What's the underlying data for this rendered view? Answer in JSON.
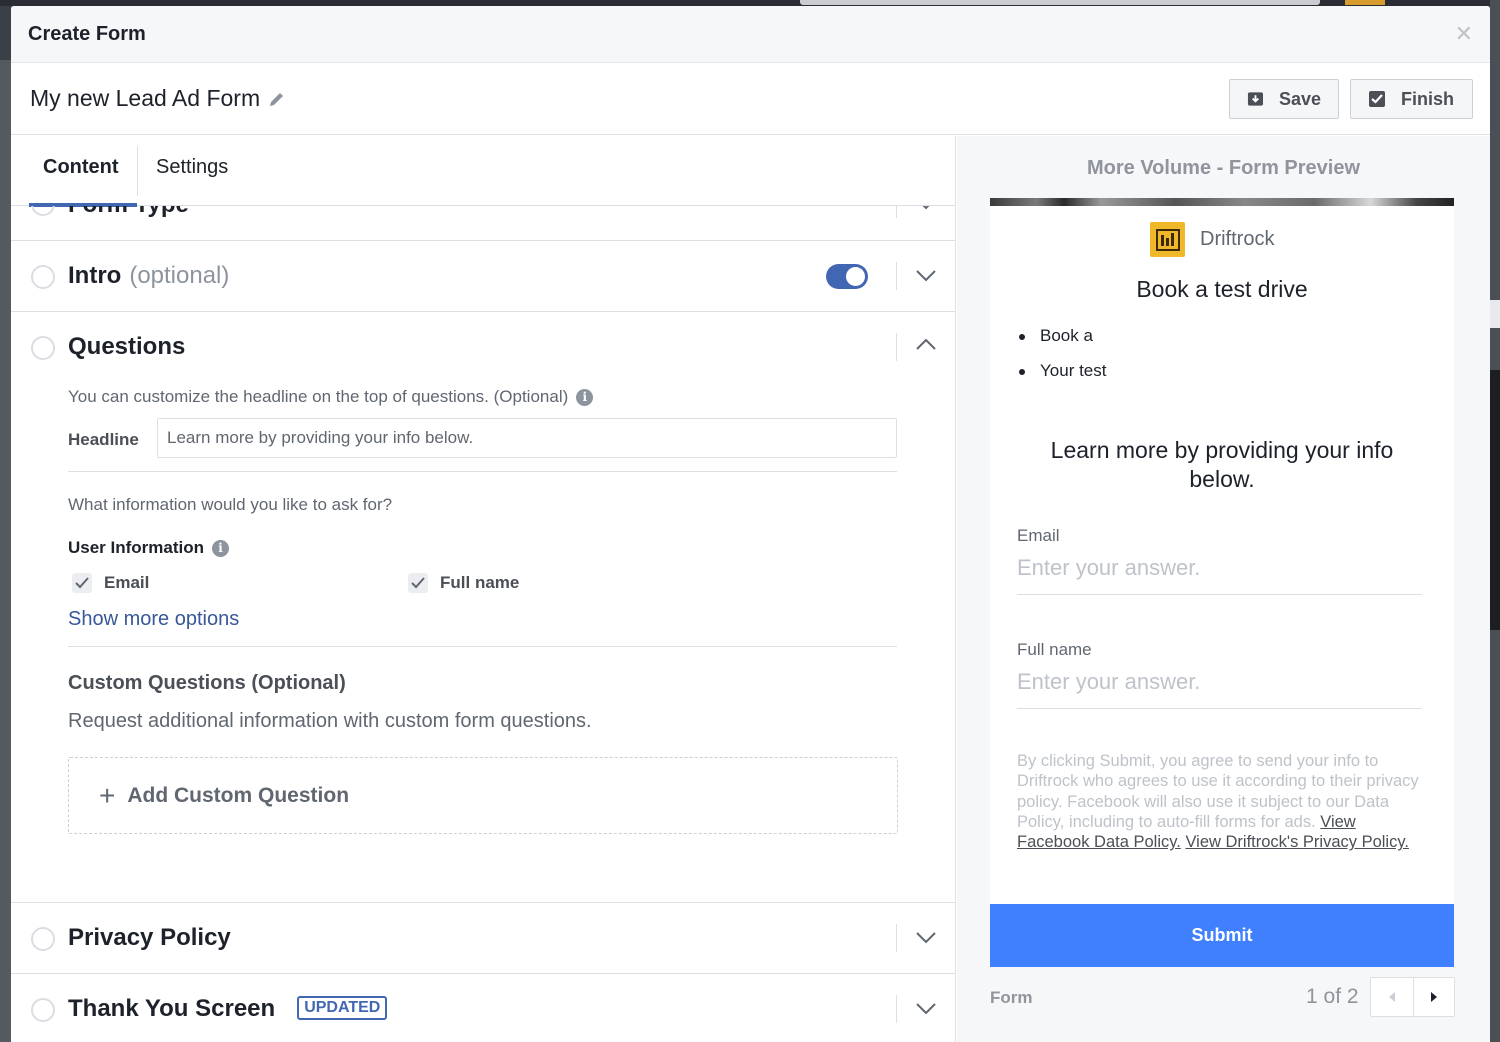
{
  "modal": {
    "title": "Create Form",
    "close_icon": "close-icon"
  },
  "form": {
    "name": "My new Lead Ad Form",
    "save_label": "Save",
    "finish_label": "Finish"
  },
  "tabs": [
    {
      "label": "Content",
      "active": true
    },
    {
      "label": "Settings",
      "active": false
    }
  ],
  "sections": {
    "form_type": {
      "title": "Form Type"
    },
    "intro": {
      "title": "Intro",
      "optional": "(optional)",
      "enabled": true
    },
    "questions": {
      "title": "Questions",
      "hint": "You can customize the headline on the top of questions. (Optional)",
      "headline_label": "Headline",
      "headline_value": "Learn more by providing your info below.",
      "ask_text": "What information would you like to ask for?",
      "user_info_label": "User Information",
      "fields": [
        {
          "label": "Email",
          "checked": true
        },
        {
          "label": "Full name",
          "checked": true
        }
      ],
      "show_more": "Show more options",
      "custom_title": "Custom Questions (Optional)",
      "custom_desc": "Request additional information with custom form questions.",
      "add_custom": "Add Custom Question"
    },
    "privacy": {
      "title": "Privacy Policy"
    },
    "thank_you": {
      "title": "Thank You Screen",
      "badge": "UPDATED"
    }
  },
  "preview": {
    "title": "More Volume - Form Preview",
    "brand": "Driftrock",
    "headline": "Book a test drive",
    "bullets": [
      "Book a",
      "Your test"
    ],
    "questions_headline": "Learn more by providing your info below.",
    "fields": [
      {
        "label": "Email",
        "placeholder": "Enter your answer."
      },
      {
        "label": "Full name",
        "placeholder": "Enter your answer."
      }
    ],
    "disclaimer_text": "By clicking Submit, you agree to send your info to Driftrock who agrees to use it according to their privacy policy. Facebook will also use it subject to our Data Policy, including to auto-fill forms for ads.",
    "link_fb_policy": "View Facebook Data Policy.",
    "link_dr_policy": "View Driftrock's Privacy Policy.",
    "submit_label": "Submit",
    "footer_label": "Form",
    "page_indicator": "1 of 2"
  },
  "colors": {
    "accent": "#4267b2",
    "submit": "#4080ff",
    "brand_logo": "#f0b729"
  }
}
